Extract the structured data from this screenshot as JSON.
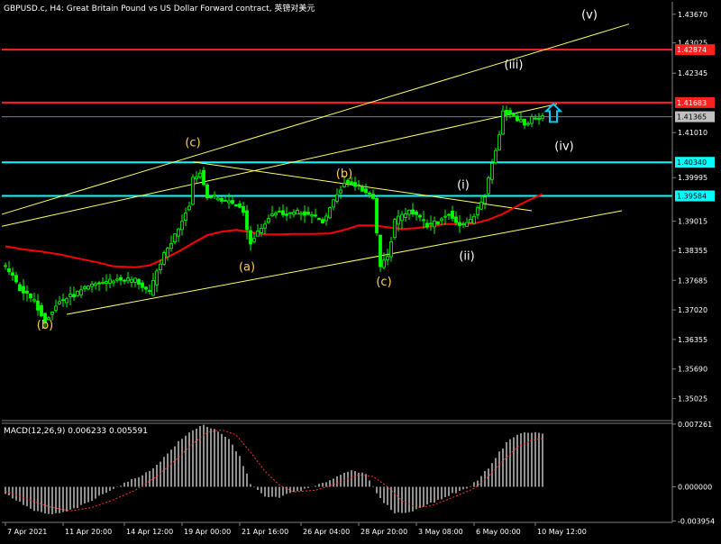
{
  "chart_data": {
    "type": "candlestick",
    "symbol_title": "GBPUSD.c, H4:  Great Britain Pound vs US Dollar Forward contract, 英镑对美元",
    "colors": {
      "background": "#000000",
      "axis": "#c0c0c0",
      "text": "#ffffff",
      "candle_up": "#00ff00",
      "candle_down": "#00ff00",
      "ma": "#ff0000",
      "channel": "#ffff66",
      "red_level": "#ff2020",
      "cyan_level": "#00ffff",
      "grey_level": "#708090",
      "wave_primary": "#ffd24d",
      "wave_minor": "#ffffff",
      "arrow": "#00ccff",
      "macd_hist": "#c0c0c0",
      "macd_signal": "#ff3030"
    },
    "price_axis": {
      "ticks": [
        "1.43670",
        "1.43025",
        "1.42345",
        "1.41010",
        "1.39995",
        "1.39015",
        "1.38355",
        "1.37685",
        "1.37020",
        "1.36355",
        "1.35690",
        "1.35025"
      ],
      "ylim": [
        1.3455,
        1.4395
      ]
    },
    "level_lines": [
      {
        "label": "1.42874",
        "price": 1.42874,
        "kind": "red"
      },
      {
        "label": "1.41683",
        "price": 1.41683,
        "kind": "red"
      },
      {
        "label": "1.41365",
        "price": 1.41365,
        "kind": "grey"
      },
      {
        "label": "1.40340",
        "price": 1.4034,
        "kind": "cyan"
      },
      {
        "label": "1.39584",
        "price": 1.39584,
        "kind": "cyan"
      }
    ],
    "time_axis": {
      "labels": [
        "7 Apr 2021",
        "11 Apr 20:00",
        "14 Apr 12:00",
        "19 Apr 00:00",
        "21 Apr 16:00",
        "26 Apr 04:00",
        "28 Apr 20:00",
        "3 May 08:00",
        "6 May 00:00",
        "10 May 12:00"
      ]
    },
    "wave_labels": [
      {
        "text": "(b)",
        "bar": 11,
        "price": 1.366,
        "style": "primary"
      },
      {
        "text": "(c)",
        "bar": 52,
        "price": 1.407,
        "style": "primary"
      },
      {
        "text": "(a)",
        "bar": 67,
        "price": 1.379,
        "style": "primary"
      },
      {
        "text": "(b)",
        "bar": 94,
        "price": 1.4,
        "style": "primary"
      },
      {
        "text": "(c)",
        "bar": 105,
        "price": 1.3757,
        "style": "primary"
      },
      {
        "text": "(i)",
        "bar": 127,
        "price": 1.3975,
        "style": "minor"
      },
      {
        "text": "(ii)",
        "bar": 128,
        "price": 1.3815,
        "style": "minor"
      },
      {
        "text": "(iii)",
        "bar": 141,
        "price": 1.4245,
        "style": "minor"
      },
      {
        "text": "(iv)",
        "bar": 155,
        "price": 1.4062,
        "style": "minor"
      },
      {
        "text": "(v)",
        "bar": 162,
        "price": 1.4358,
        "style": "minor"
      }
    ],
    "trend_lines": [
      {
        "name": "upper-channel",
        "from": {
          "bar": -1,
          "price": 1.3917
        },
        "to": {
          "bar": 173,
          "price": 1.4345
        }
      },
      {
        "name": "middle-channel",
        "from": {
          "bar": -1,
          "price": 1.389
        },
        "to": {
          "bar": 153,
          "price": 1.4165
        }
      },
      {
        "name": "lower-channel",
        "from": {
          "bar": 17,
          "price": 1.3692
        },
        "to": {
          "bar": 171,
          "price": 1.3925
        }
      },
      {
        "name": "triangle-top",
        "from": {
          "bar": 52,
          "price": 1.4035
        },
        "to": {
          "bar": 146,
          "price": 1.3925
        }
      }
    ],
    "arrow": {
      "bar": 152,
      "price": 1.4145,
      "direction": "up"
    },
    "bars": 150,
    "price_points": [
      [
        0,
        1.38
      ],
      [
        4,
        1.375
      ],
      [
        8,
        1.372
      ],
      [
        11,
        1.368
      ],
      [
        15,
        1.372
      ],
      [
        20,
        1.374
      ],
      [
        25,
        1.376
      ],
      [
        30,
        1.377
      ],
      [
        36,
        1.377
      ],
      [
        40,
        1.374
      ],
      [
        43,
        1.381
      ],
      [
        47,
        1.387
      ],
      [
        51,
        1.394
      ],
      [
        52,
        1.4
      ],
      [
        54,
        1.401
      ],
      [
        56,
        1.396
      ],
      [
        60,
        1.395
      ],
      [
        64,
        1.394
      ],
      [
        66,
        1.392
      ],
      [
        68,
        1.385
      ],
      [
        70,
        1.388
      ],
      [
        74,
        1.392
      ],
      [
        78,
        1.392
      ],
      [
        83,
        1.392
      ],
      [
        88,
        1.39
      ],
      [
        92,
        1.396
      ],
      [
        94,
        1.399
      ],
      [
        98,
        1.398
      ],
      [
        102,
        1.395
      ],
      [
        104,
        1.38
      ],
      [
        106,
        1.382
      ],
      [
        108,
        1.39
      ],
      [
        112,
        1.393
      ],
      [
        117,
        1.389
      ],
      [
        120,
        1.39
      ],
      [
        123,
        1.392
      ],
      [
        125,
        1.39
      ],
      [
        127,
        1.389
      ],
      [
        129,
        1.39
      ],
      [
        131,
        1.393
      ],
      [
        133,
        1.396
      ],
      [
        135,
        1.403
      ],
      [
        137,
        1.41
      ],
      [
        138,
        1.415
      ],
      [
        140,
        1.414
      ],
      [
        142,
        1.413
      ],
      [
        144,
        1.412
      ],
      [
        147,
        1.4136
      ],
      [
        149,
        1.4136
      ]
    ],
    "ma_points": [
      [
        0,
        1.3845
      ],
      [
        5,
        1.3838
      ],
      [
        10,
        1.3833
      ],
      [
        15,
        1.3827
      ],
      [
        20,
        1.3818
      ],
      [
        25,
        1.381
      ],
      [
        30,
        1.38
      ],
      [
        36,
        1.3798
      ],
      [
        40,
        1.3802
      ],
      [
        44,
        1.3817
      ],
      [
        48,
        1.3833
      ],
      [
        52,
        1.3852
      ],
      [
        56,
        1.387
      ],
      [
        60,
        1.3878
      ],
      [
        64,
        1.3882
      ],
      [
        68,
        1.3877
      ],
      [
        72,
        1.3872
      ],
      [
        76,
        1.3872
      ],
      [
        80,
        1.3873
      ],
      [
        85,
        1.3873
      ],
      [
        90,
        1.3874
      ],
      [
        94,
        1.3882
      ],
      [
        98,
        1.3892
      ],
      [
        102,
        1.3892
      ],
      [
        106,
        1.3888
      ],
      [
        110,
        1.3884
      ],
      [
        114,
        1.3886
      ],
      [
        118,
        1.389
      ],
      [
        122,
        1.3895
      ],
      [
        126,
        1.3895
      ],
      [
        130,
        1.3896
      ],
      [
        134,
        1.3905
      ],
      [
        138,
        1.3918
      ],
      [
        142,
        1.3936
      ],
      [
        146,
        1.3952
      ],
      [
        149,
        1.3962
      ]
    ],
    "macd": {
      "title": "MACD(12,26,9) 0.006233 0.005591",
      "ticks": [
        "0.007261",
        "0.000000",
        "-0.003954"
      ],
      "ylim": [
        -0.00412,
        0.00735
      ],
      "hist_points": [
        [
          0,
          -0.0008
        ],
        [
          4,
          -0.0018
        ],
        [
          8,
          -0.0028
        ],
        [
          12,
          -0.0032
        ],
        [
          16,
          -0.003
        ],
        [
          20,
          -0.0024
        ],
        [
          24,
          -0.0016
        ],
        [
          28,
          -0.0006
        ],
        [
          32,
          0.0002
        ],
        [
          36,
          0.001
        ],
        [
          40,
          0.0018
        ],
        [
          44,
          0.0034
        ],
        [
          48,
          0.0052
        ],
        [
          52,
          0.0066
        ],
        [
          55,
          0.0072
        ],
        [
          58,
          0.0066
        ],
        [
          62,
          0.0055
        ],
        [
          65,
          0.0035
        ],
        [
          68,
          0.0004
        ],
        [
          72,
          -0.0012
        ],
        [
          76,
          -0.0012
        ],
        [
          80,
          -0.0006
        ],
        [
          84,
          -0.0002
        ],
        [
          88,
          0.0004
        ],
        [
          92,
          0.0012
        ],
        [
          96,
          0.002
        ],
        [
          100,
          0.0014
        ],
        [
          104,
          -0.0014
        ],
        [
          108,
          -0.003
        ],
        [
          112,
          -0.003
        ],
        [
          116,
          -0.0022
        ],
        [
          120,
          -0.0016
        ],
        [
          124,
          -0.0008
        ],
        [
          128,
          -0.0002
        ],
        [
          131,
          0.0008
        ],
        [
          134,
          0.0022
        ],
        [
          137,
          0.004
        ],
        [
          140,
          0.0056
        ],
        [
          143,
          0.0062
        ],
        [
          146,
          0.0063
        ],
        [
          149,
          0.0062
        ]
      ],
      "signal_points": [
        [
          0,
          -0.0005
        ],
        [
          6,
          -0.0014
        ],
        [
          12,
          -0.0023
        ],
        [
          18,
          -0.0028
        ],
        [
          24,
          -0.0024
        ],
        [
          30,
          -0.0015
        ],
        [
          36,
          -0.0004
        ],
        [
          42,
          0.0012
        ],
        [
          48,
          0.0034
        ],
        [
          52,
          0.005
        ],
        [
          56,
          0.0063
        ],
        [
          60,
          0.0066
        ],
        [
          64,
          0.006
        ],
        [
          68,
          0.004
        ],
        [
          72,
          0.0018
        ],
        [
          76,
          0.0002
        ],
        [
          80,
          -0.0006
        ],
        [
          86,
          -0.0004
        ],
        [
          92,
          0.0004
        ],
        [
          98,
          0.0014
        ],
        [
          102,
          0.0012
        ],
        [
          106,
          0.0
        ],
        [
          110,
          -0.0016
        ],
        [
          114,
          -0.0024
        ],
        [
          118,
          -0.0022
        ],
        [
          122,
          -0.0016
        ],
        [
          126,
          -0.0009
        ],
        [
          130,
          -0.0002
        ],
        [
          134,
          0.0012
        ],
        [
          138,
          0.003
        ],
        [
          142,
          0.0046
        ],
        [
          146,
          0.0054
        ],
        [
          149,
          0.0056
        ]
      ]
    }
  }
}
